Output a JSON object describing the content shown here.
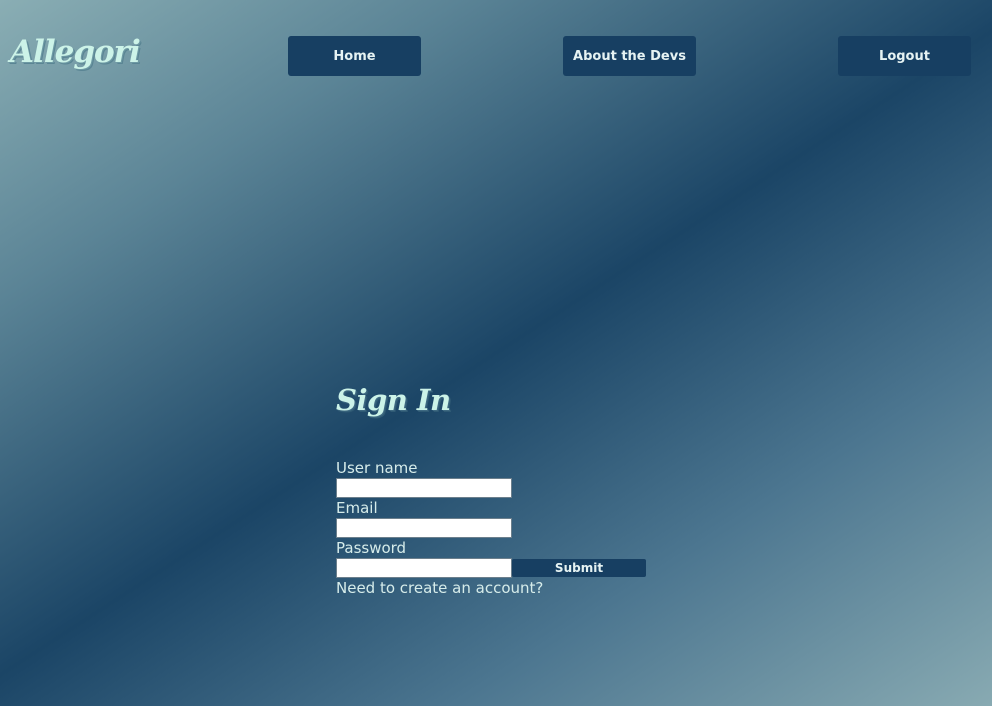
{
  "header": {
    "brand": "Allegori",
    "nav": {
      "home_label": "Home",
      "devs_label": "About the Devs",
      "logout_label": "Logout"
    }
  },
  "signin": {
    "title": "Sign In",
    "username_label": "User name",
    "username_value": "",
    "email_label": "Email",
    "email_value": "",
    "password_label": "Password",
    "password_value": "",
    "submit_label": "Submit",
    "create_account_link": "Need to create an account?"
  },
  "colors": {
    "nav_button_bg": "#173f62",
    "brand_text": "#ccf3e8",
    "gradient_dark": "#1b4566",
    "gradient_light": "#8aaeb4"
  }
}
